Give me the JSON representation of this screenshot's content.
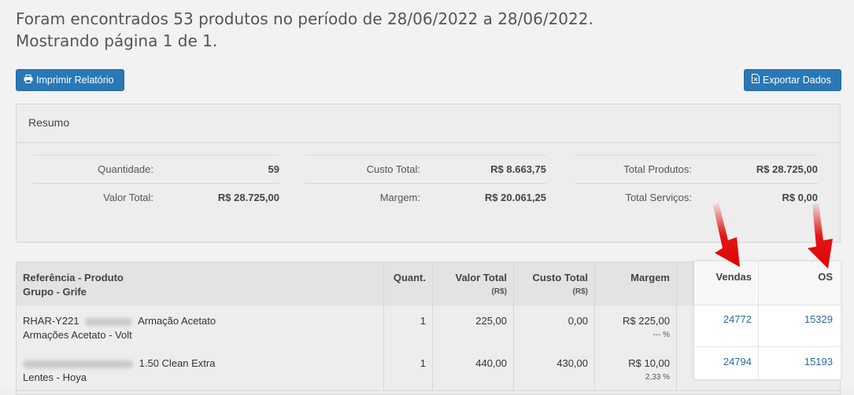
{
  "header": {
    "line1": "Foram encontrados 53 produtos no período de 28/06/2022 a 28/06/2022.",
    "line2": "Mostrando página 1 de 1."
  },
  "toolbar": {
    "print_label": "Imprimir Relatório",
    "print_icon": "printer-icon",
    "export_label": "Exportar Dados",
    "export_icon": "file-export-icon"
  },
  "summary": {
    "title": "Resumo",
    "items": [
      {
        "label": "Quantidade:",
        "value": "59"
      },
      {
        "label": "Valor Total:",
        "value": "R$ 28.725,00"
      },
      {
        "label": "Custo Total:",
        "value": "R$ 8.663,75"
      },
      {
        "label": "Margem:",
        "value": "R$ 20.061,25"
      },
      {
        "label": "Total Produtos:",
        "value": "R$ 28.725,00"
      },
      {
        "label": "Total Serviços:",
        "value": "R$ 0,00"
      }
    ]
  },
  "table": {
    "headers": {
      "ref_line1": "Referência - Produto",
      "ref_line2": "Grupo - Grife",
      "quant": "Quant.",
      "valor_total": "Valor Total",
      "valor_total_unit": "(R$)",
      "custo_total": "Custo Total",
      "custo_total_unit": "(R$)",
      "margem": "Margem",
      "vendas": "Vendas",
      "os": "OS"
    },
    "rows": [
      {
        "ref_code": "RHAR-Y221",
        "product": "Armação Acetato",
        "group": "Armações Acetato - Volt",
        "quant": "1",
        "valor_total": "225,00",
        "custo_total": "0,00",
        "margem": "R$ 225,00",
        "margem_pct": "--- %",
        "vendas": "24772",
        "os": "15329"
      },
      {
        "ref_code": "",
        "product": "1.50 Clean Extra",
        "group": "Lentes - Hoya",
        "quant": "1",
        "valor_total": "440,00",
        "custo_total": "430,00",
        "margem": "R$ 10,00",
        "margem_pct": "2,33 %",
        "vendas": "24794",
        "os": "15193"
      }
    ]
  },
  "colors": {
    "button_bg": "#2a78b5",
    "link": "#2a6aa6",
    "arrow": "#e00000"
  }
}
